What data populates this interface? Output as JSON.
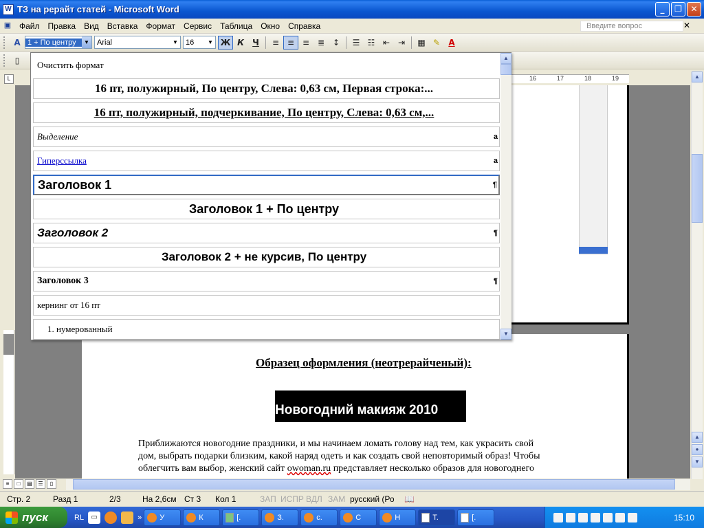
{
  "window": {
    "title": "ТЗ на рерайт статей - Microsoft Word",
    "icon": "W"
  },
  "menu": {
    "items": [
      "Файл",
      "Правка",
      "Вид",
      "Вставка",
      "Формат",
      "Сервис",
      "Таблица",
      "Окно",
      "Справка"
    ],
    "ask_placeholder": "Введите вопрос"
  },
  "formatting": {
    "style_value": "1 + По центру",
    "font_value": "Arial",
    "size_value": "16",
    "bold": "Ж",
    "italic": "К",
    "underline": "Ч"
  },
  "ruler": {
    "labels": [
      "16",
      "17",
      "18",
      "19"
    ]
  },
  "style_dropdown": {
    "clear_label": "Очистить формат",
    "items": [
      {
        "label": "16 пт, полужирный, По центру, Слева:  0,63 см, Первая строка:...",
        "mark": ""
      },
      {
        "label": "16 пт, полужирный, подчеркивание, По центру, Слева:  0,63 см,...",
        "mark": ""
      },
      {
        "label": "Выделение",
        "mark": "a"
      },
      {
        "label": "Гиперссылка",
        "mark": "a"
      },
      {
        "label": "Заголовок 1",
        "mark": "¶"
      },
      {
        "label": "Заголовок 1 + По центру",
        "mark": ""
      },
      {
        "label": "Заголовок 2",
        "mark": "¶"
      },
      {
        "label": "Заголовок 2 + не курсив, По центру",
        "mark": ""
      },
      {
        "label": "Заголовок 3",
        "mark": "¶"
      },
      {
        "label": "кернинг от 16 пт",
        "mark": ""
      },
      {
        "label": "1.  нумерованный",
        "mark": ""
      }
    ]
  },
  "document": {
    "sample_heading": "Образец оформления (неотрерайченый):",
    "article_title": "Новогодний макияж 2010",
    "paragraph_lines": [
      "Приближаются новогодние праздники, и мы начинаем ломать голову над тем, как украсить свой",
      "дом, выбрать подарки близким, какой наряд одеть и как создать свой неповторимый образ! Чтобы"
    ],
    "paragraph_line3_before": "облегчить вам выбор, женский сайт ",
    "paragraph_line3_link": "owoman.ru",
    "paragraph_line3_after": " представляет несколько образов для новогоднего"
  },
  "status": {
    "page": "Стр. 2",
    "section": "Разд 1",
    "pages": "2/3",
    "position": "На 2,6см",
    "line": "Ст 3",
    "column": "Кол 1",
    "rec": "ЗАП",
    "trk": "ИСПР",
    "ext": "ВДЛ",
    "ovr": "ЗАМ",
    "language": "русский (Ро"
  },
  "taskbar": {
    "start_label": "пуск",
    "lang": "RL",
    "tasks": [
      "У",
      "К",
      "[.",
      "З.",
      "с.",
      "С",
      "Н",
      "Т.",
      "[."
    ],
    "clock": "15:10"
  }
}
